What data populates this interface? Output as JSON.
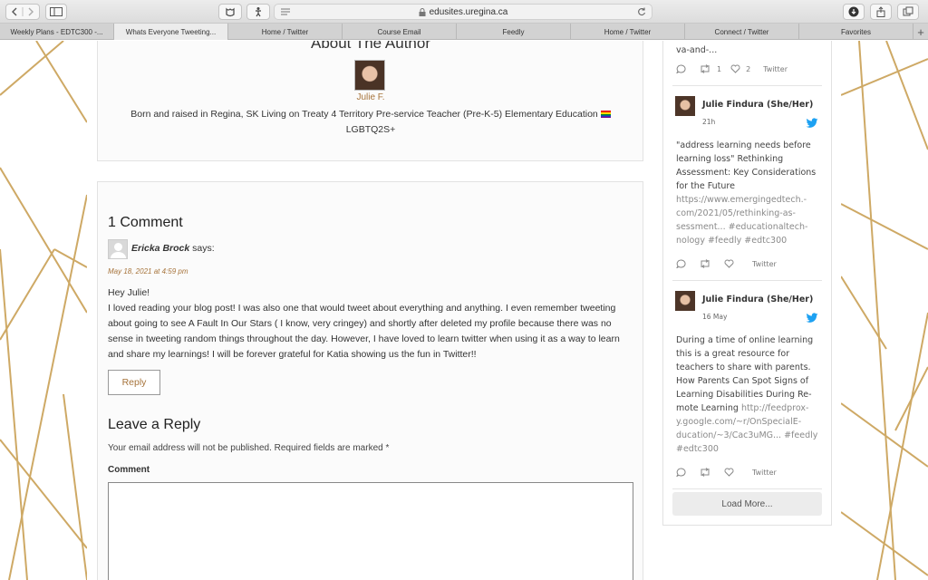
{
  "browser": {
    "url": "edusites.uregina.ca",
    "tabs": [
      {
        "label": "Weekly Plans - EDTC300 -...",
        "active": false
      },
      {
        "label": "Whats Everyone Tweeting...",
        "active": true
      },
      {
        "label": "Home / Twitter",
        "active": false
      },
      {
        "label": "Course Email",
        "active": false
      },
      {
        "label": "Feedly",
        "active": false
      },
      {
        "label": "Home / Twitter",
        "active": false
      },
      {
        "label": "Connect / Twitter",
        "active": false
      },
      {
        "label": "Favorites",
        "active": false
      }
    ]
  },
  "author": {
    "heading": "About The Author",
    "name": "Julie F.",
    "bio": "Born and raised in Regina, SK Living on Treaty 4 Territory Pre-service Teacher (Pre-K-5) Elementary Education",
    "bio_line2": "LGBTQ2S+"
  },
  "comments": {
    "heading": "1 Comment",
    "commenter": "Ericka Brock",
    "says": "says:",
    "date": "May 18, 2021 at 4:59 pm",
    "greeting": "Hey Julie!",
    "body": "I loved reading your blog post! I was also one that would tweet about everything and anything. I even remember tweeting about going to see A Fault In Our Stars ( I know, very cringey) and shortly after deleted my profile because there was no sense in tweeting random things throughout the day. However, I have loved to learn twitter when using it as a way to learn and share my learnings! I will be forever grateful for Katia showing us the fun in Twitter!!",
    "reply_label": "Reply"
  },
  "reply_form": {
    "heading": "Leave a Reply",
    "note": "Your email address will not be published. Required fields are marked *",
    "comment_label": "Comment"
  },
  "twitter": {
    "top_fragment": "va-and-...",
    "top_actions": {
      "retweets": "1",
      "likes": "2",
      "source": "Twitter"
    },
    "tweets": [
      {
        "author": "Julie Findura (She/Her)",
        "time": "21h",
        "text": "\"address learning needs before learning loss\" Rethinking Assessment: Key Considerations for the Future",
        "link": "https://www.emergingedtech.-com/2021/05/rethinking-as-sessment... #educationaltech-nology #feedly #edtc300",
        "source": "Twitter"
      },
      {
        "author": "Julie Findura (She/Her)",
        "time": "16 May",
        "text": "During a time of online learning this is a great resource for teachers to share with parents. How Parents Can Spot Signs of Learning Disabilities During Re-mote Learning",
        "link": "http://feedprox-y.google.com/~r/OnSpecialE-ducation/~3/Cac3uMG... #feedly #edtc300",
        "source": "Twitter"
      }
    ],
    "load_more": "Load More...",
    "accent_color": "#1da1f2"
  }
}
